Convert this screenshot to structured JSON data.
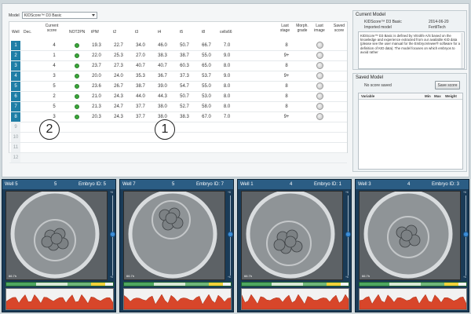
{
  "model": {
    "label": "Model",
    "selected": "KIDScore™ D3 Basic"
  },
  "grid": {
    "headers": {
      "well": "Well",
      "dec": "Dec.",
      "score": "Current score",
      "not2pn": "NOT2PN",
      "tpnf": "tPNf",
      "t2": "t2",
      "t3": "t3",
      "t4": "t4",
      "t5": "t5",
      "t8": "t8",
      "cells66": "cells66",
      "last_stage": "Last stage",
      "morph_grade": "Morph. grade",
      "last_image": "Last image",
      "saved_score": "Saved score"
    },
    "rows": [
      {
        "well": "1",
        "score": "4",
        "tpnf": "19.3",
        "t2": "22.7",
        "t3": "34.0",
        "t4": "46.0",
        "t5": "50.7",
        "t8": "66.7",
        "cells66": "7.0",
        "last_stage": "8"
      },
      {
        "well": "2",
        "score": "1",
        "tpnf": "22.0",
        "t2": "25.3",
        "t3": "27.0",
        "t4": "38.3",
        "t5": "38.7",
        "t8": "55.0",
        "cells66": "9.0",
        "last_stage": "9+"
      },
      {
        "well": "3",
        "score": "4",
        "tpnf": "23.7",
        "t2": "27.3",
        "t3": "40.7",
        "t4": "40.7",
        "t5": "60.3",
        "t8": "65.0",
        "cells66": "8.0",
        "last_stage": "8"
      },
      {
        "well": "4",
        "score": "3",
        "tpnf": "20.0",
        "t2": "24.0",
        "t3": "35.3",
        "t4": "36.7",
        "t5": "37.3",
        "t8": "53.7",
        "cells66": "9.0",
        "last_stage": "9+"
      },
      {
        "well": "5",
        "score": "5",
        "tpnf": "23.6",
        "t2": "26.7",
        "t3": "38.7",
        "t4": "39.0",
        "t5": "54.7",
        "t8": "55.0",
        "cells66": "8.0",
        "last_stage": "8"
      },
      {
        "well": "6",
        "score": "2",
        "tpnf": "21.0",
        "t2": "24.3",
        "t3": "44.0",
        "t4": "44.3",
        "t5": "50.7",
        "t8": "53.0",
        "cells66": "8.0",
        "last_stage": "8"
      },
      {
        "well": "7",
        "score": "5",
        "tpnf": "21.3",
        "t2": "24.7",
        "t3": "37.7",
        "t4": "38.0",
        "t5": "52.7",
        "t8": "58.0",
        "cells66": "8.0",
        "last_stage": "8"
      },
      {
        "well": "8",
        "score": "3",
        "tpnf": "20.3",
        "t2": "24.3",
        "t3": "37.7",
        "t4": "38.0",
        "t5": "38.3",
        "t8": "67.0",
        "cells66": "7.0",
        "last_stage": "9+"
      }
    ],
    "empty_wells": [
      "9",
      "10",
      "11",
      "12"
    ],
    "markers": [
      "2",
      "1"
    ]
  },
  "current_model": {
    "title": "Current Model",
    "name": "KIDScore™ D3 Basic",
    "date": "2014-06-20",
    "source": "Imported model",
    "vendor": "FertilTech",
    "description": "KIDScore™ D3 Basic is defined by Vitrolife A/S based on the knowledge and experience extracted from our available KID data (please see the user manual for the EmbryoViewer® software for a definition of KID data). The model focuses on which embryos to avoid rather"
  },
  "saved_model": {
    "title": "Saved Model",
    "status": "No score saved",
    "save_button": "Save score",
    "columns": [
      "Variable",
      "Min",
      "Max",
      "Weight"
    ]
  },
  "viewers": [
    {
      "well": "Well 5",
      "score": "5",
      "embryo": "Embryo ID: 5",
      "time": "66.7h",
      "slider_top": "+6",
      "slider_bottom": "+6"
    },
    {
      "well": "Well 7",
      "score": "5",
      "embryo": "Embryo ID: 7",
      "time": "66.7h",
      "slider_top": "+6",
      "slider_bottom": "+6"
    },
    {
      "well": "Well 1",
      "score": "4",
      "embryo": "Embryo ID: 1",
      "time": "66.7h",
      "slider_top": "+6",
      "slider_bottom": "+6"
    },
    {
      "well": "Well 3",
      "score": "4",
      "embryo": "Embryo ID: 3",
      "time": "66.7h",
      "slider_top": "+6",
      "slider_bottom": "+6"
    }
  ],
  "colors": {
    "accent": "#1f7ea6",
    "header": "#2b5d84",
    "green": "#3aa63a"
  }
}
